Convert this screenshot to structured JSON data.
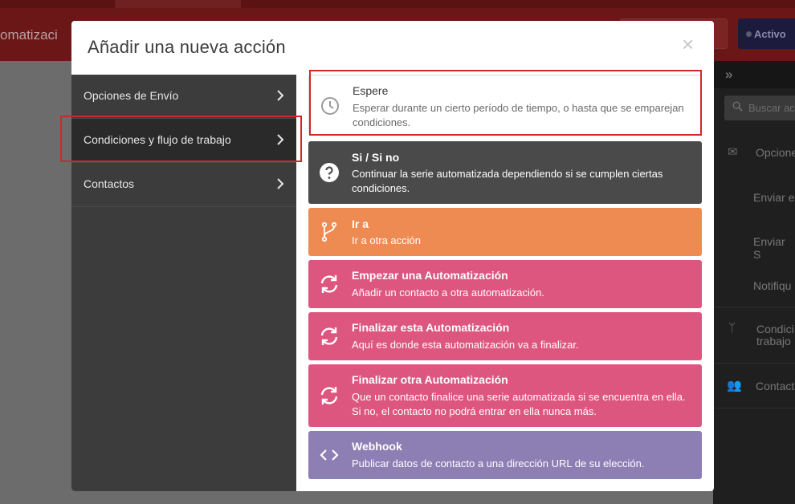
{
  "background": {
    "app_title": "omatizaci",
    "active_button": "Activo",
    "search_placeholder": "Buscar ac",
    "sidebar_items": [
      "Opcione",
      "Enviar e",
      "Enviar S",
      "Notifiqu",
      "Condici",
      "trabajo",
      "Contact"
    ]
  },
  "modal": {
    "title": "Añadir una nueva acción",
    "close": "×",
    "nav": [
      {
        "label": "Opciones de Envío",
        "active": false
      },
      {
        "label": "Condiciones y flujo de trabajo",
        "active": true
      },
      {
        "label": "Contactos",
        "active": false
      }
    ],
    "actions": [
      {
        "title": "Espere",
        "description": "Esperar durante un cierto período de tiempo, o hasta que se emparejan condiciones.",
        "icon": "clock-icon",
        "color": "#ffffff"
      },
      {
        "title": "Si / Si no",
        "description": "Continuar la serie automatizada dependiendo si se cumplen ciertas condiciones.",
        "icon": "question-icon",
        "color": "#4a4a4a"
      },
      {
        "title": "Ir a",
        "description": "Ir a otra acción",
        "icon": "branch-icon",
        "color": "#ee8b52"
      },
      {
        "title": "Empezar una Automatización",
        "description": "Añadir un contacto a otra automatización.",
        "icon": "sync-icon",
        "color": "#dc5680"
      },
      {
        "title": "Finalizar esta Automatización",
        "description": "Aquí es donde esta automatización va a finalizar.",
        "icon": "sync-icon",
        "color": "#dc5680"
      },
      {
        "title": "Finalizar otra Automatización",
        "description": "Que un contacto finalice una serie automatizada si se encuentra en ella. Si no, el contacto no podrá entrar en ella nunca más.",
        "icon": "sync-icon",
        "color": "#dc5680"
      },
      {
        "title": "Webhook",
        "description": "Publicar datos de contacto a una dirección URL de su elección.",
        "icon": "code-icon",
        "color": "#8d7eb4"
      }
    ]
  },
  "colors": {
    "highlight": "#d0272b",
    "nav_bg": "#3c3c3c",
    "nav_active_bg": "#2a2a2a"
  }
}
